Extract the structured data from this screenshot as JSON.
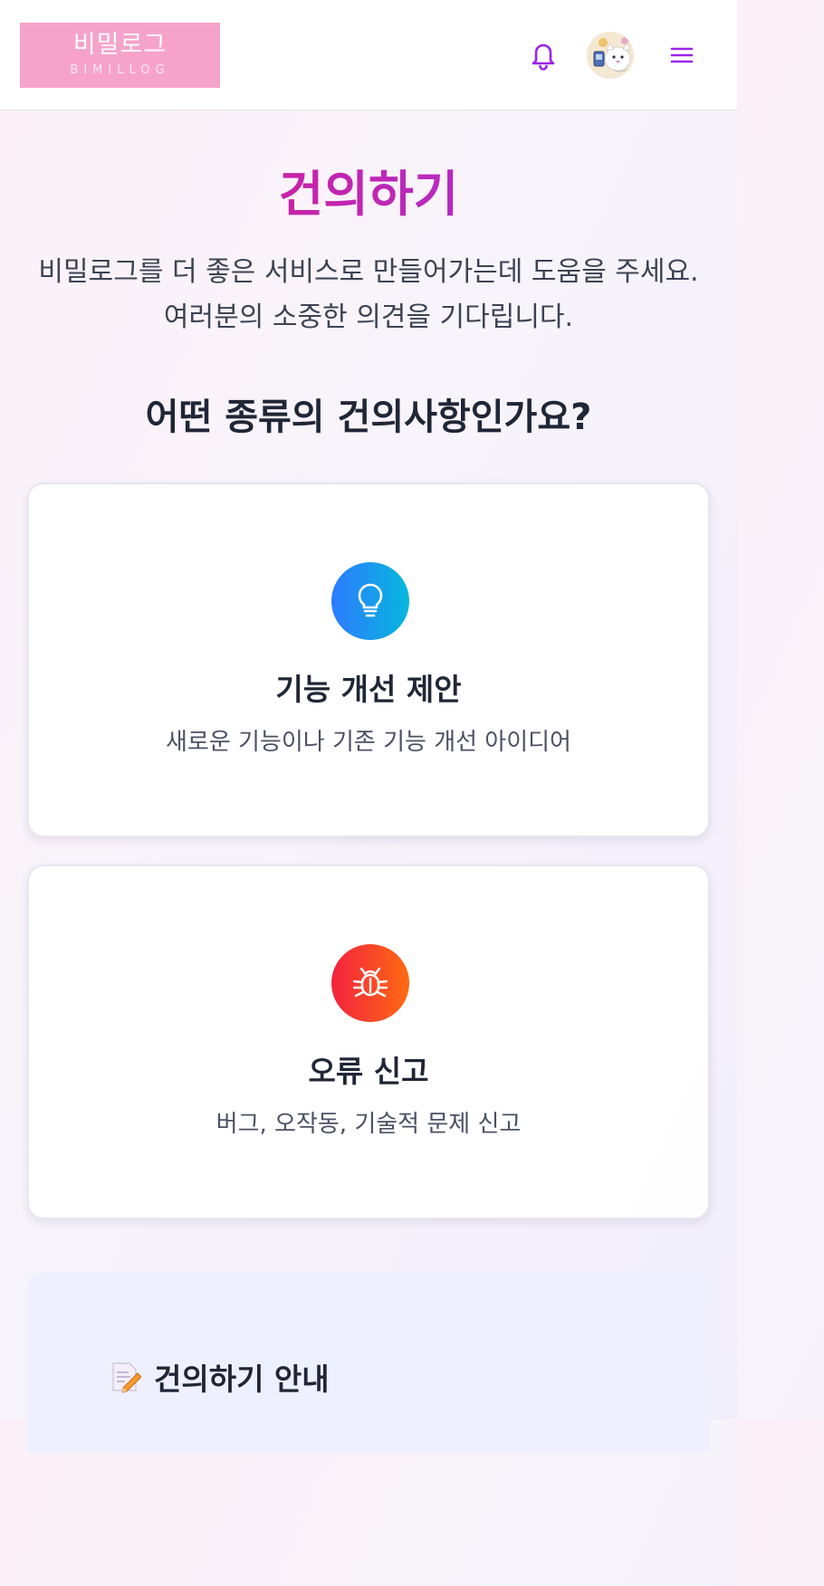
{
  "header": {
    "logo_main": "비밀로그",
    "logo_sub": "BIMILLOG",
    "notification_icon": "bell-icon",
    "avatar_icon": "avatar",
    "menu_icon": "hamburger-menu-icon",
    "accent_color": "#9b23e8"
  },
  "hero": {
    "title": "건의하기",
    "description": "비밀로그를 더 좋은 서비스로 만들어가는데 도움을 주세요. 여러분의 소중한 의견을 기다립니다."
  },
  "section": {
    "question": "어떤 종류의 건의사항인가요?"
  },
  "cards": [
    {
      "icon": "lightbulb-icon",
      "title": "기능 개선 제안",
      "description": "새로운 기능이나 기존 기능 개선 아이디어",
      "colors": [
        "#2d7bff",
        "#06b7dd"
      ]
    },
    {
      "icon": "bug-icon",
      "title": "오류 신고",
      "description": "버그, 오작동, 기술적 문제 신고",
      "colors": [
        "#f3223f",
        "#ff6a12"
      ]
    }
  ],
  "guide": {
    "icon": "memo-icon",
    "title": "건의하기 안내"
  }
}
